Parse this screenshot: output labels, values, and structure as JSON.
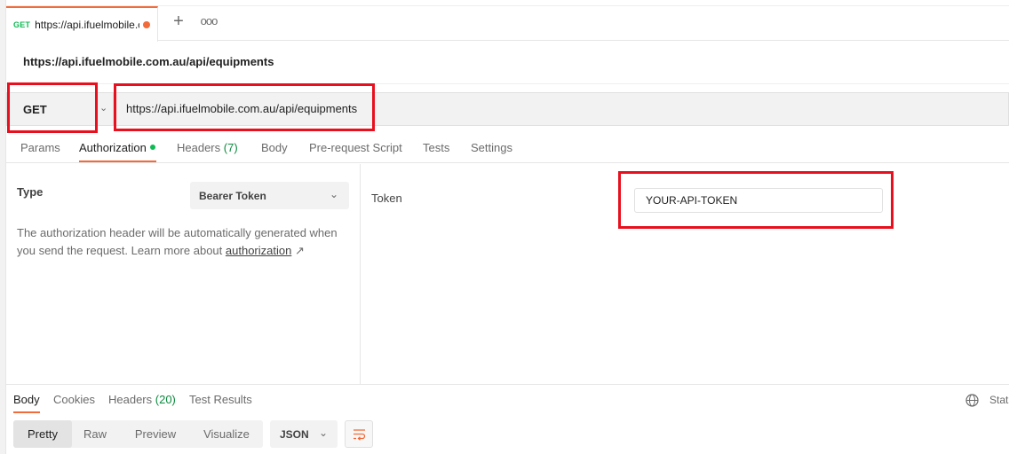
{
  "tab": {
    "method": "GET",
    "title": "https://api.ifuelmobile.c",
    "plus": "+",
    "more": "ooo"
  },
  "request": {
    "name": "https://api.ifuelmobile.com.au/api/equipments",
    "method": "GET",
    "url": "https://api.ifuelmobile.com.au/api/equipments"
  },
  "request_tabs": {
    "params": "Params",
    "authorization": "Authorization",
    "headers": "Headers",
    "headers_count": "(7)",
    "body": "Body",
    "prerequest": "Pre-request Script",
    "tests": "Tests",
    "settings": "Settings"
  },
  "auth": {
    "type_label": "Type",
    "type_value": "Bearer Token",
    "description": "The authorization header will be automatically generated when you send the request. Learn more about ",
    "link": "authorization",
    "link_arrow": "↗",
    "token_label": "Token",
    "token_value": "YOUR-API-TOKEN"
  },
  "response": {
    "tabs": {
      "body": "Body",
      "cookies": "Cookies",
      "headers": "Headers",
      "headers_count": "(20)",
      "tests": "Test Results"
    },
    "status_label": "Stat",
    "views": {
      "pretty": "Pretty",
      "raw": "Raw",
      "preview": "Preview",
      "visualize": "Visualize"
    },
    "format": "JSON"
  },
  "colors": {
    "accent": "#f26b3a",
    "success": "#0cbb52",
    "highlight": "#e8101e"
  }
}
